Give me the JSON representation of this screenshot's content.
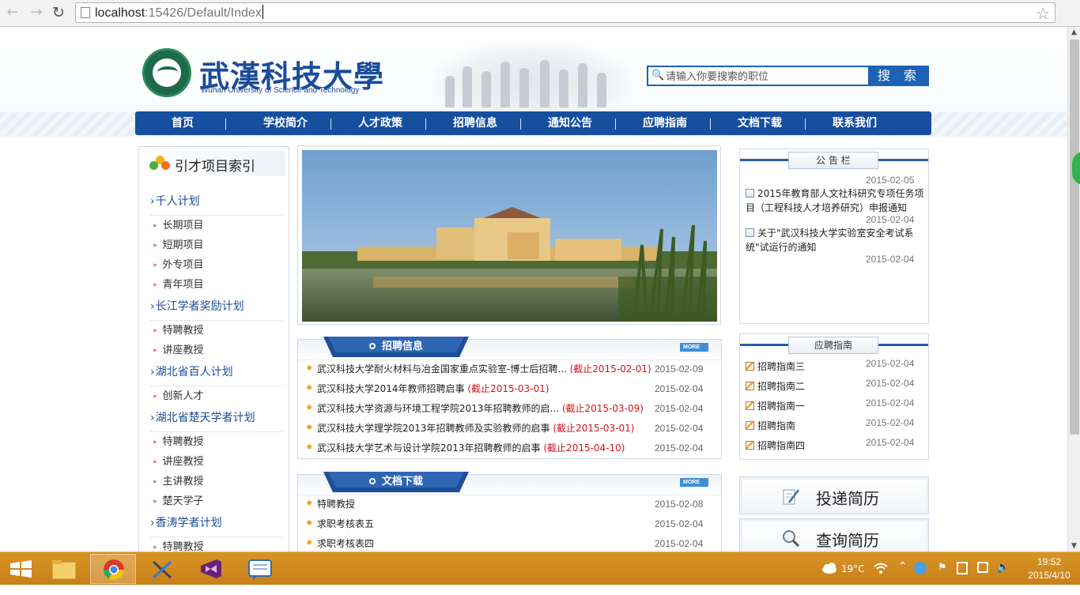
{
  "browser": {
    "url_host": "localhost",
    "url_rest": ":15426/Default/Index"
  },
  "header": {
    "logo_cn": "武漢科技大學",
    "logo_en": "Wuhan University of Science and Technology",
    "search_placeholder": "请输入你要搜索的职位",
    "search_button": "搜 索"
  },
  "nav": [
    "首页",
    "学校简介",
    "人才政策",
    "招聘信息",
    "通知公告",
    "应聘指南",
    "文档下载",
    "联系我们"
  ],
  "sidebar": {
    "title": "引才项目索引",
    "groups": [
      {
        "name": "千人计划",
        "items": [
          "长期项目",
          "短期项目",
          "外专项目",
          "青年项目"
        ]
      },
      {
        "name": "长江学者奖励计划",
        "items": [
          "特聘教授",
          "讲座教授"
        ]
      },
      {
        "name": "湖北省百人计划",
        "items": [
          "创新人才"
        ]
      },
      {
        "name": "湖北省楚天学者计划",
        "items": [
          "特聘教授",
          "讲座教授",
          "主讲教授",
          "楚天学子"
        ]
      },
      {
        "name": "香涛学者计划",
        "items": [
          "特聘教授"
        ]
      }
    ]
  },
  "recruit": {
    "tab": "招聘信息",
    "more": "MORE",
    "rows": [
      {
        "title": "武汉科技大学耐火材料与冶金国家重点实验室-博士后招聘...",
        "deadline": "(截止2015-02-01)",
        "date": "2015-02-09"
      },
      {
        "title": "武汉科技大学2014年教师招聘启事",
        "deadline": "(截止2015-03-01)",
        "date": "2015-02-04"
      },
      {
        "title": "武汉科技大学资源与环境工程学院2013年招聘教师的启...",
        "deadline": "(截止2015-03-09)",
        "date": "2015-02-04"
      },
      {
        "title": "武汉科技大学理学院2013年招聘教师及实验教师的启事",
        "deadline": "(截止2015-03-01)",
        "date": "2015-02-04"
      },
      {
        "title": "武汉科技大学艺术与设计学院2013年招聘教师的启事",
        "deadline": "(截止2015-04-10)",
        "date": "2015-02-04"
      }
    ]
  },
  "docs": {
    "tab": "文档下载",
    "more": "MORE",
    "rows": [
      {
        "title": "特聘教授",
        "date": "2015-02-08"
      },
      {
        "title": "求职考核表五",
        "date": "2015-02-04"
      },
      {
        "title": "求职考核表四",
        "date": "2015-02-04"
      }
    ]
  },
  "notice": {
    "title": "公 告 栏",
    "dates": [
      "2015-02-05",
      "2015-02-04",
      "2015-02-04"
    ],
    "items": [
      "2015年教育部人文社科研究专项任务项目（工程科技人才培养研究）申报通知",
      "关于\"武汉科技大学实验室安全考试系统\"试运行的通知"
    ]
  },
  "guide": {
    "title": "应聘指南",
    "items": [
      {
        "title": "招聘指南三",
        "date": "2015-02-04"
      },
      {
        "title": "招聘指南二",
        "date": "2015-02-04"
      },
      {
        "title": "招聘指南一",
        "date": "2015-02-04"
      },
      {
        "title": "招聘指南",
        "date": "2015-02-04"
      },
      {
        "title": "招聘指南四",
        "date": "2015-02-04"
      }
    ]
  },
  "actions": {
    "submit": "投递简历",
    "query": "查询简历"
  },
  "taskbar": {
    "weather": "19°C",
    "time": "19:52",
    "date": "2015/4/10"
  },
  "colors": {
    "nav_blue": "#164f9e",
    "deadline_red": "#d1141e",
    "taskbar": "#d08a20"
  }
}
